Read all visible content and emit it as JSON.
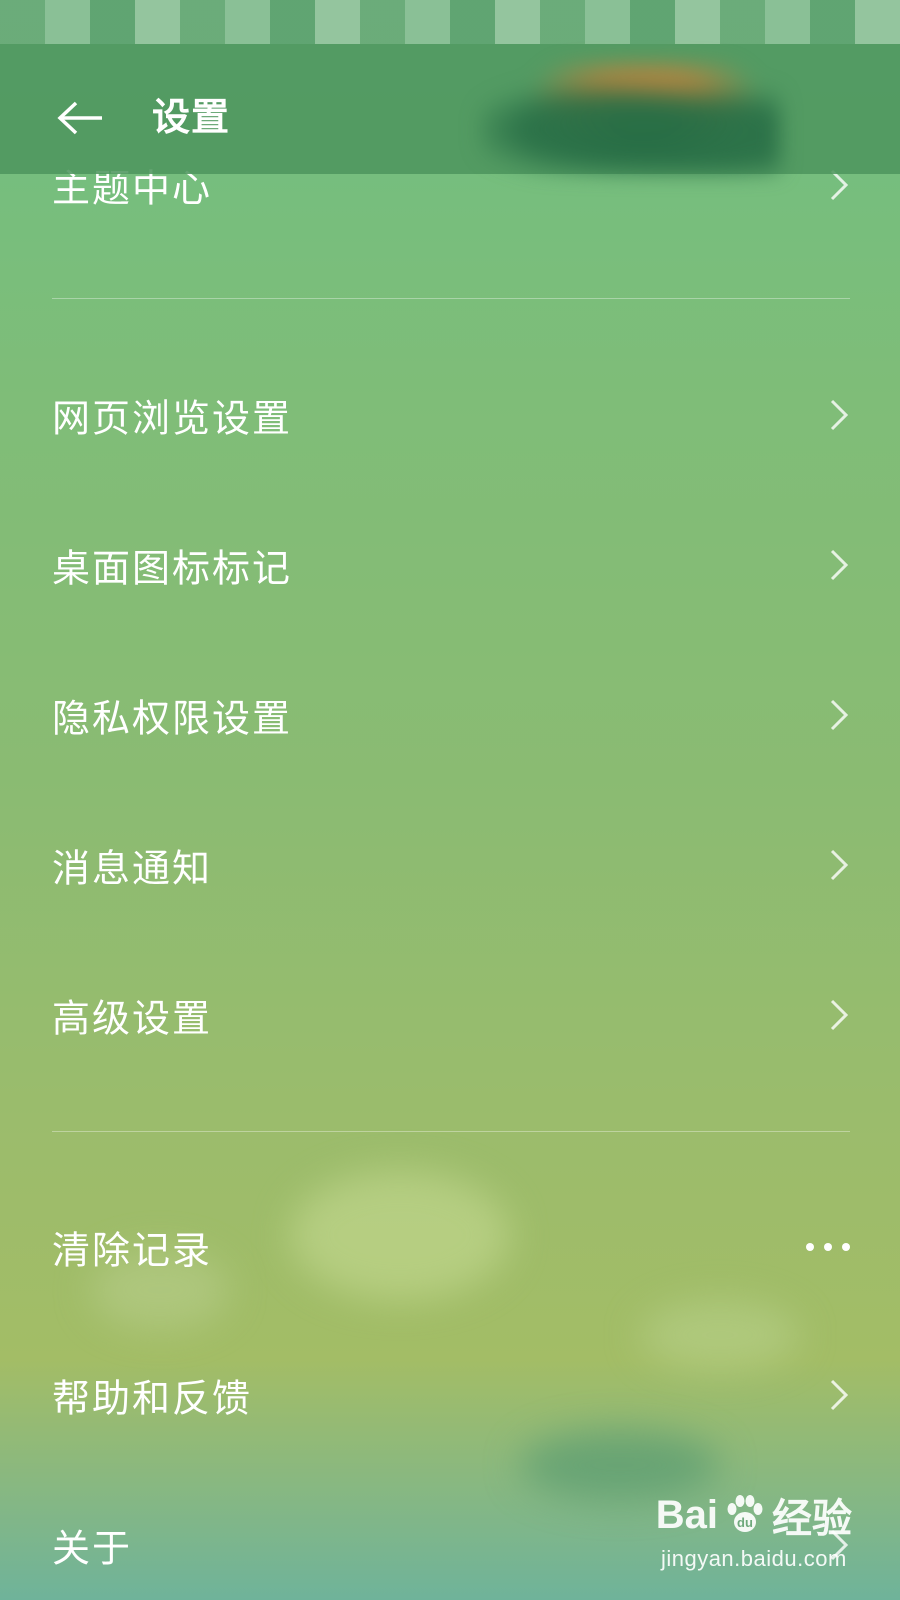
{
  "header": {
    "title": "设置"
  },
  "menu": {
    "partial_item": "主题中心",
    "items": [
      {
        "label": "网页浏览设置"
      },
      {
        "label": "桌面图标标记"
      },
      {
        "label": "隐私权限设置"
      },
      {
        "label": "消息通知"
      },
      {
        "label": "高级设置"
      },
      {
        "label": "清除记录"
      },
      {
        "label": "帮助和反馈"
      },
      {
        "label": "关于"
      }
    ]
  },
  "icons": {
    "back": "arrow-left-icon",
    "chevron": "chevron-right-icon",
    "more": "more-dots-icon"
  },
  "watermark": {
    "brand": "Bai",
    "brand_end": "经验",
    "url": "jingyan.baidu.com"
  },
  "colors": {
    "text": "#ffffff",
    "header": "#4e965f"
  }
}
